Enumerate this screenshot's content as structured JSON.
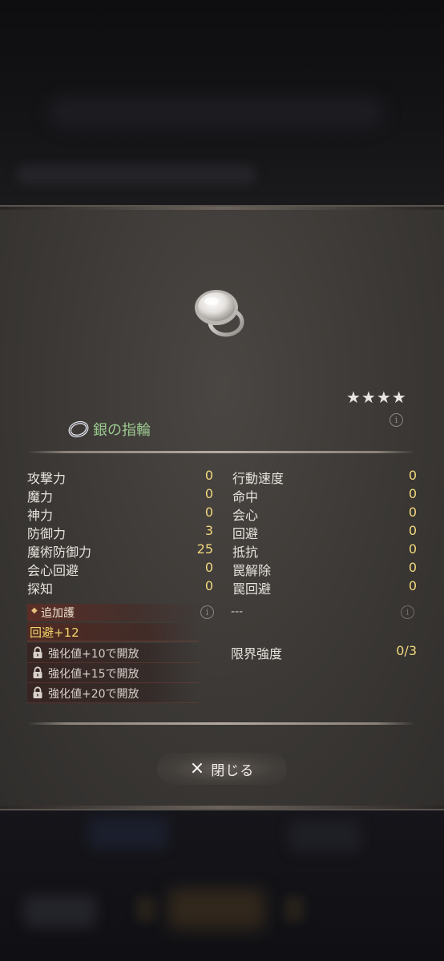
{
  "rarity_stars": "★★★★",
  "item": {
    "name": "銀の指輪"
  },
  "stats_left": [
    {
      "label": "攻撃力",
      "value": "0"
    },
    {
      "label": "魔力",
      "value": "0"
    },
    {
      "label": "神力",
      "value": "0"
    },
    {
      "label": "防御力",
      "value": "3"
    },
    {
      "label": "魔術防御力",
      "value": "25"
    },
    {
      "label": "会心回避",
      "value": "0"
    },
    {
      "label": "探知",
      "value": "0"
    }
  ],
  "stats_right": [
    {
      "label": "行動速度",
      "value": "0"
    },
    {
      "label": "命中",
      "value": "0"
    },
    {
      "label": "会心",
      "value": "0"
    },
    {
      "label": "回避",
      "value": "0"
    },
    {
      "label": "抵抗",
      "value": "0"
    },
    {
      "label": "罠解除",
      "value": "0"
    },
    {
      "label": "罠回避",
      "value": "0"
    }
  ],
  "extra": {
    "header": "追加護",
    "active": "回避+12",
    "locked": [
      "強化値+10で開放",
      "強化値+15で開放",
      "強化値+20で開放"
    ],
    "right_placeholder": "---"
  },
  "limit": {
    "label": "限界強度",
    "value": "0/3"
  },
  "close_button": {
    "icon": "×",
    "label": "閉じる"
  },
  "icons": {
    "info": "i"
  }
}
